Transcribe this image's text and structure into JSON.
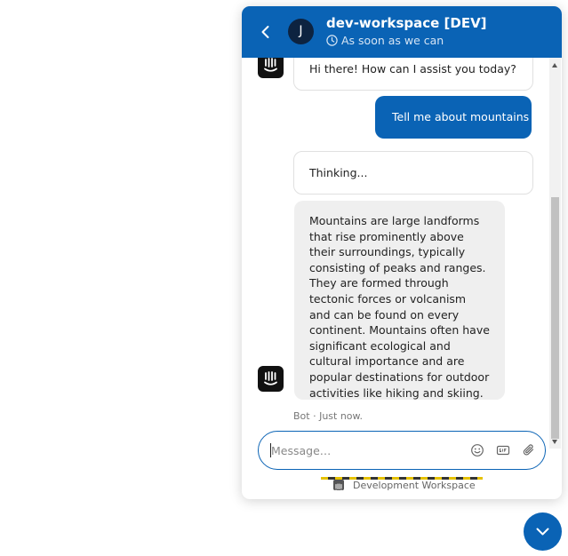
{
  "header": {
    "title": "dev-workspace [DEV]",
    "subtitle": "As soon as we can",
    "avatar_initial": "J"
  },
  "messages": [
    {
      "author": "bot",
      "text": "Hi there! How can I assist you today?"
    },
    {
      "author": "user",
      "text": "Tell me about mountains"
    },
    {
      "author": "bot",
      "text": "Thinking..."
    },
    {
      "author": "bot",
      "text": "Mountains are large landforms that rise prominently above their surroundings, typically consisting of peaks and ranges. They are formed through tectonic forces or volcanism and can be found on every continent. Mountains often have significant ecological and cultural importance and are popular destinations for outdoor activities like hiking and skiing."
    }
  ],
  "last_meta": "Bot · Just now.",
  "composer": {
    "placeholder": "Message…",
    "value": ""
  },
  "footer": {
    "brand_text": "Development Workspace"
  },
  "colors": {
    "accent": "#0a63b5",
    "bot_bubble": "#efefef"
  }
}
